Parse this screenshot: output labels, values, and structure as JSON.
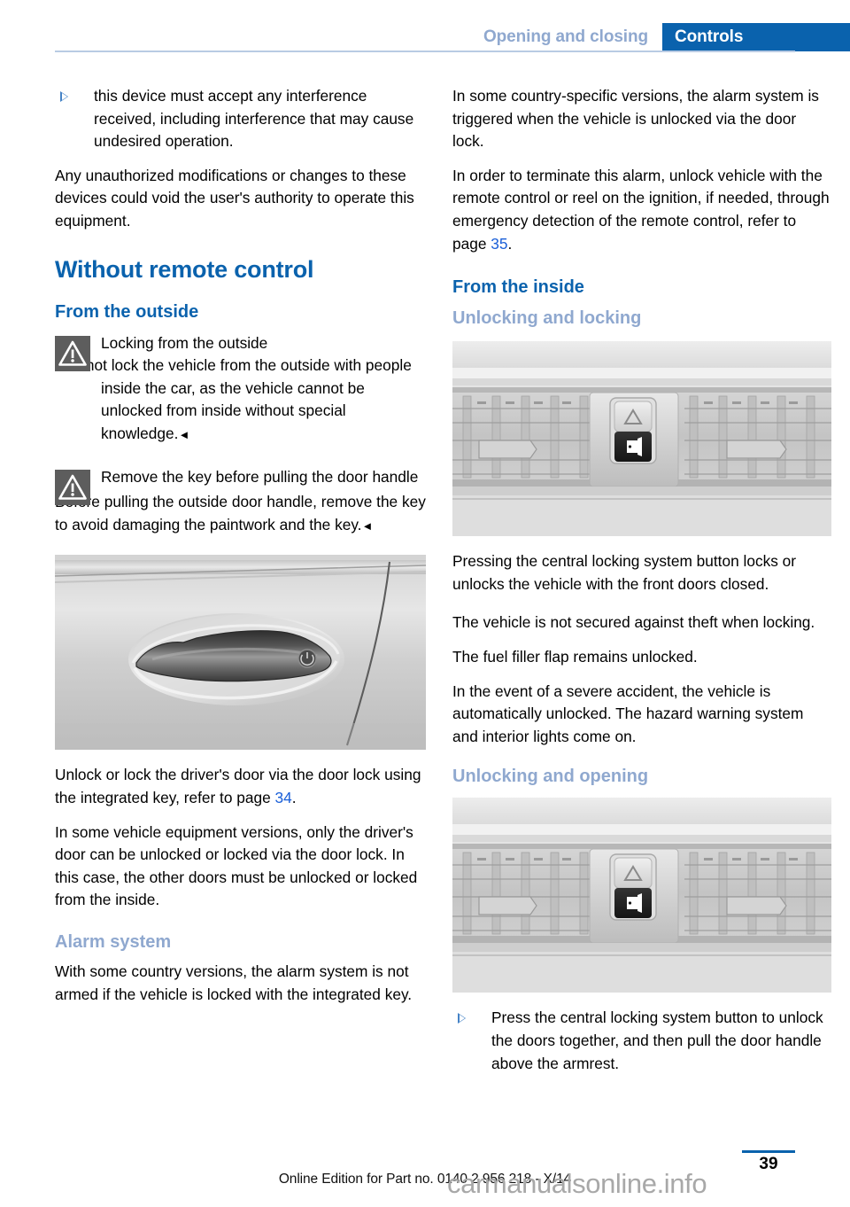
{
  "header": {
    "chapter": "Opening and closing",
    "section": "Controls"
  },
  "left_column": {
    "bullet_1": "this device must accept any interference received, including interference that may cause undesired operation.",
    "para_1": "Any unauthorized modifications or changes to these devices could void the user's authority to operate this equipment.",
    "heading_main": "Without remote control",
    "heading_outside": "From the outside",
    "warning_1": {
      "icon": "warning-triangle-icon",
      "title": "Locking from the outside",
      "body": "Do not lock the vehicle from the outside with people inside the car, as the vehicle cannot be unlocked from inside without special knowledge.",
      "endmark": "◄"
    },
    "warning_2": {
      "icon": "warning-triangle-icon",
      "title": "Remove the key before pulling the door handle",
      "body": "Before pulling the outside door handle, remove the key to avoid damaging the paintwork and the key.",
      "endmark": "◄"
    },
    "figure_door_handle": "car-door-handle-photo",
    "para_2_before": "Unlock or lock the driver's door via the door lock using the integrated key, refer to page ",
    "para_2_link": "34",
    "para_2_after": ".",
    "para_3": "In some vehicle equipment versions, only the driver's door can be unlocked or locked via the door lock. In this case, the other doors must be unlocked or locked from the inside.",
    "heading_alarm": "Alarm system",
    "para_4": "With some country versions, the alarm system is not armed if the vehicle is locked with the integrated key."
  },
  "right_column": {
    "para_1": "In some country-specific versions, the alarm system is triggered when the vehicle is unlocked via the door lock.",
    "para_2_before": "In order to terminate this alarm, unlock vehicle with the remote control or reel on the ignition, if needed, through emergency detection of the remote control, refer to page ",
    "para_2_link": "35",
    "para_2_after": ".",
    "heading_inside": "From the inside",
    "heading_unlocking_locking": "Unlocking and locking",
    "figure_console_1": "dashboard-central-locking-button-photo",
    "para_3": "Pressing the central locking system button locks or unlocks the vehicle with the front doors closed.",
    "para_4": "The vehicle is not secured against theft when locking.",
    "para_5": "The fuel filler flap remains unlocked.",
    "para_6": "In the event of a severe accident, the vehicle is automatically unlocked. The hazard warning system and interior lights come on.",
    "heading_unlocking_opening": "Unlocking and opening",
    "figure_console_2": "dashboard-central-locking-button-photo",
    "bullet_1": "Press the central locking system button to unlock the doors together, and then pull the door handle above the armrest."
  },
  "footer": {
    "edition": "Online Edition for Part no. 0140 2 956 218 - X/14",
    "page_number": "39",
    "watermark": "carmanualsonline.info"
  },
  "colors": {
    "heading_blue": "#0a62ad",
    "subheading_light_blue": "#8fa8cf",
    "link_blue": "#1a5fd8",
    "rule_blue": "#b9cbe3",
    "warn_icon_gray": "#5d5d5d"
  }
}
